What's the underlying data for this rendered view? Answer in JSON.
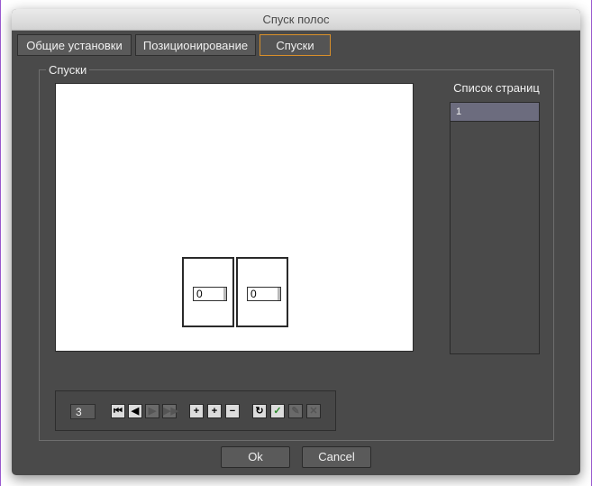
{
  "window": {
    "title": "Спуск полос"
  },
  "tabs": [
    {
      "label": "Общие установки"
    },
    {
      "label": "Позиционирование"
    },
    {
      "label": "Спуски"
    }
  ],
  "group": {
    "label": "Спуски"
  },
  "canvas": {
    "pages": [
      {
        "value": "0"
      },
      {
        "value": "0"
      }
    ]
  },
  "page_list": {
    "title": "Список страниц",
    "items": [
      {
        "label": "1"
      }
    ]
  },
  "toolbar": {
    "count": "3",
    "icons": [
      "first-icon",
      "previous-icon",
      "next-icon",
      "last-icon",
      "add-page-icon",
      "add-blank-icon",
      "remove-icon",
      "refresh-icon",
      "check-icon",
      "edit-icon",
      "delete-icon"
    ],
    "glyphs": {
      "first": "⏮",
      "prev": "◀",
      "next": "▶",
      "last": "▶▶",
      "add_page": "+",
      "add_blank": "+",
      "remove": "−",
      "refresh": "↻",
      "check": "✓",
      "edit": "✎",
      "delete": "✕"
    }
  },
  "buttons": {
    "ok": "Ok",
    "cancel": "Cancel"
  },
  "colors": {
    "window_bg": "#4a4a4a",
    "active_tab_border": "#d9902a",
    "list_selection": "#6c6c7e"
  }
}
